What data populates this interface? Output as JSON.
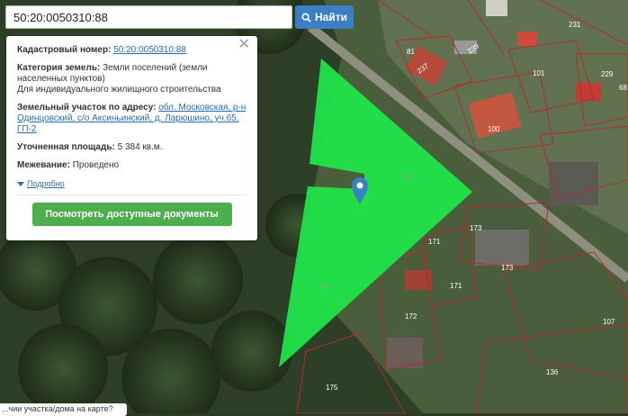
{
  "search": {
    "query": "50:20:0050310:88",
    "button_label": "Найти"
  },
  "info_panel": {
    "cadastral_label": "Кадастровый номер:",
    "cadastral_number": "50:20:0050310:88",
    "category_label": "Категория земель:",
    "category_value": "Земли поселений (земли населенных пунктов)",
    "usage_value": "Для индивидуального жилищного строительства",
    "address_label": "Земельный участок по адресу:",
    "address_value": "обл. Московская, р-н Одинцовский, с/о Аксиньинский, д. Ларюшино, уч.65, ГП-2",
    "area_label": "Уточненная площадь:",
    "area_value": "5 384 кв.м.",
    "survey_label": "Межевание:",
    "survey_value": "Проведено",
    "more_link": "Подробно",
    "docs_button": "Посмотреть доступные документы"
  },
  "tooltip_text": "...чии участка/дома на карте?",
  "parcel_labels": [
    "81",
    "237",
    "239",
    "231",
    "101",
    "229",
    "68",
    "100",
    "173",
    "171",
    "173",
    "171",
    "172",
    "88",
    "107",
    "136",
    "175"
  ],
  "colors": {
    "parcel_fill": "#1ee84a",
    "boundary": "#b42a35",
    "button_blue": "#3b7fc4",
    "button_green": "#4cae4c"
  }
}
